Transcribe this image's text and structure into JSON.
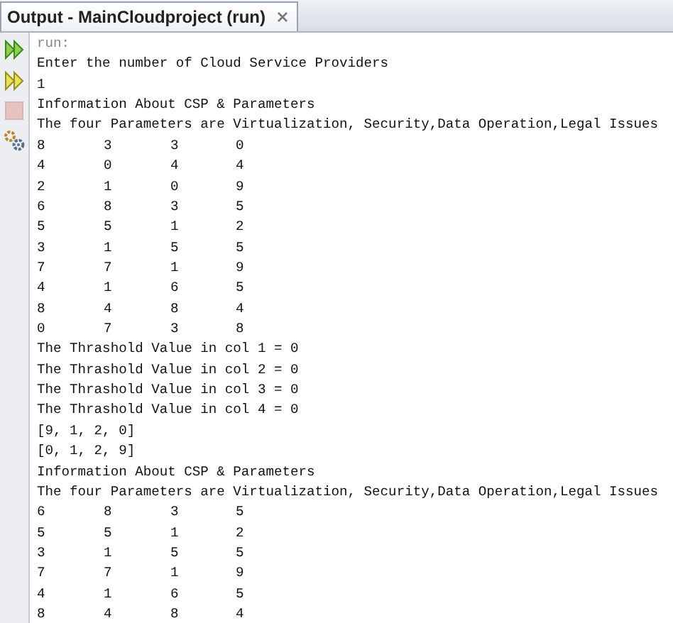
{
  "tab": {
    "title": "Output - MainCloudproject (run)",
    "selected": true
  },
  "toolbar": [
    {
      "kind": "rerun"
    },
    {
      "kind": "rerun-params"
    },
    {
      "kind": "stop",
      "disabled": true
    },
    {
      "kind": "settings"
    }
  ],
  "output": [
    {
      "kind": "meta",
      "text": "run:"
    },
    {
      "kind": "text",
      "text": "Enter the number of Cloud Service Providers"
    },
    {
      "kind": "text",
      "text": "1"
    },
    {
      "kind": "text",
      "text": "Information About CSP & Parameters"
    },
    {
      "kind": "text",
      "text": "The four Parameters are Virtualization, Security,Data Operation,Legal Issues"
    },
    {
      "kind": "row",
      "cells": [
        "8",
        "3",
        "3",
        "0"
      ]
    },
    {
      "kind": "row",
      "cells": [
        "4",
        "0",
        "4",
        "4"
      ]
    },
    {
      "kind": "row",
      "cells": [
        "2",
        "1",
        "0",
        "9"
      ]
    },
    {
      "kind": "row",
      "cells": [
        "6",
        "8",
        "3",
        "5"
      ]
    },
    {
      "kind": "row",
      "cells": [
        "5",
        "5",
        "1",
        "2"
      ]
    },
    {
      "kind": "row",
      "cells": [
        "3",
        "1",
        "5",
        "5"
      ]
    },
    {
      "kind": "row",
      "cells": [
        "7",
        "7",
        "1",
        "9"
      ]
    },
    {
      "kind": "row",
      "cells": [
        "4",
        "1",
        "6",
        "5"
      ]
    },
    {
      "kind": "row",
      "cells": [
        "8",
        "4",
        "8",
        "4"
      ]
    },
    {
      "kind": "row",
      "cells": [
        "0",
        "7",
        "3",
        "8"
      ]
    },
    {
      "kind": "text",
      "text": "The Thrashold Value in col 1 = 0"
    },
    {
      "kind": "text",
      "text": "The Thrashold Value in col 2 = 0"
    },
    {
      "kind": "text",
      "text": "The Thrashold Value in col 3 = 0"
    },
    {
      "kind": "text",
      "text": "The Thrashold Value in col 4 = 0"
    },
    {
      "kind": "text",
      "text": "[9, 1, 2, 0]"
    },
    {
      "kind": "text",
      "text": "[0, 1, 2, 9]"
    },
    {
      "kind": "text",
      "text": "Information About CSP & Parameters"
    },
    {
      "kind": "text",
      "text": "The four Parameters are Virtualization, Security,Data Operation,Legal Issues"
    },
    {
      "kind": "row",
      "cells": [
        "6",
        "8",
        "3",
        "5"
      ]
    },
    {
      "kind": "row",
      "cells": [
        "5",
        "5",
        "1",
        "2"
      ]
    },
    {
      "kind": "row",
      "cells": [
        "3",
        "1",
        "5",
        "5"
      ]
    },
    {
      "kind": "row",
      "cells": [
        "7",
        "7",
        "1",
        "9"
      ]
    },
    {
      "kind": "row",
      "cells": [
        "4",
        "1",
        "6",
        "5"
      ]
    },
    {
      "kind": "row",
      "cells": [
        "8",
        "4",
        "8",
        "4"
      ]
    }
  ]
}
